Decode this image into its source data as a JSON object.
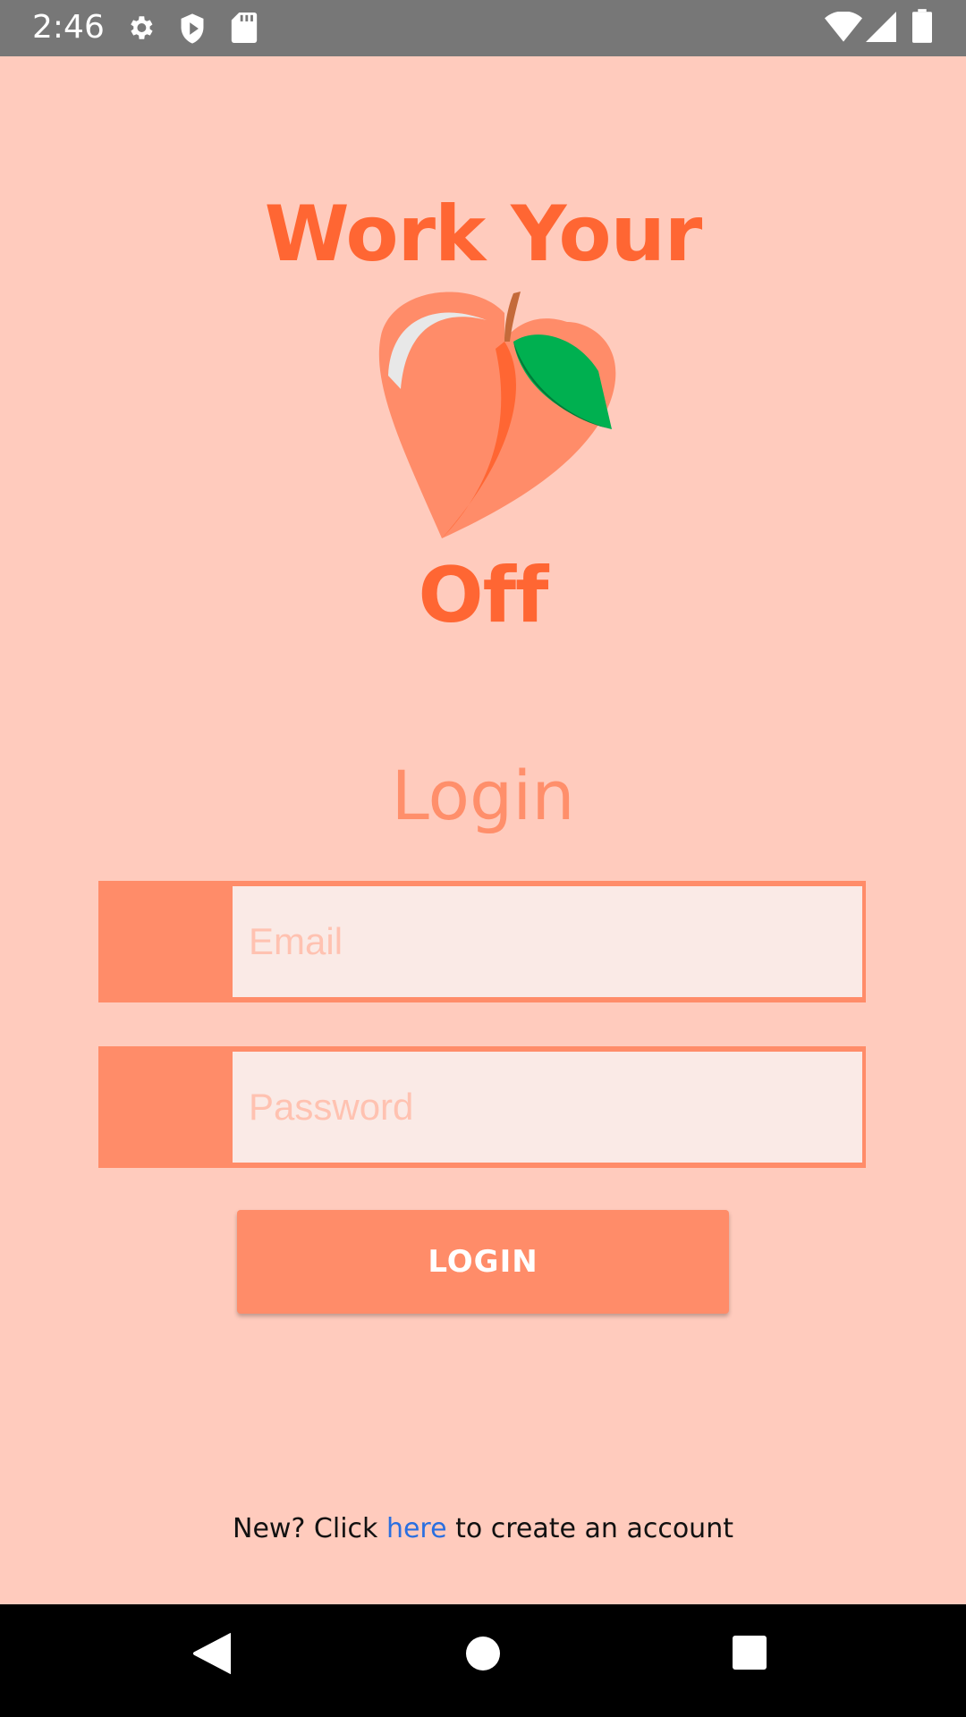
{
  "status_bar": {
    "time": "2:46",
    "icons": [
      "settings-icon",
      "shield-icon",
      "sd-card-icon",
      "wifi-icon",
      "signal-icon",
      "battery-icon"
    ]
  },
  "app": {
    "title_top": "Work Your",
    "logo": "peach-icon",
    "title_bottom": "Off"
  },
  "login": {
    "heading": "Login",
    "email_placeholder": "Email",
    "email_value": "",
    "password_placeholder": "Password",
    "password_value": "",
    "button_label": "LOGIN"
  },
  "signup": {
    "prefix": "New? Click ",
    "link": "here",
    "suffix": " to create an account"
  },
  "nav_bar": {
    "icons": [
      "back-icon",
      "home-icon",
      "recents-icon"
    ]
  },
  "colors": {
    "background": "#ffcbbd",
    "accent": "#ff6633",
    "field_accent": "#ff8c69",
    "field_fill": "#faeae6",
    "link": "#2a6fe0"
  }
}
